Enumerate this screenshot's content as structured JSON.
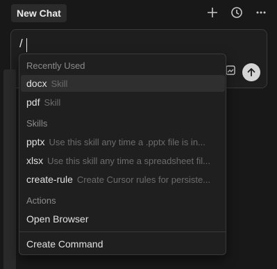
{
  "header": {
    "title": "New Chat",
    "icons": [
      "plus-icon",
      "history-icon",
      "more-icon"
    ]
  },
  "composer": {
    "value": "/",
    "icons": [
      "attach-icon",
      "arrow-up-icon"
    ]
  },
  "menu": {
    "sections": {
      "recent": "Recently Used",
      "skills": "Skills",
      "actions": "Actions"
    },
    "recent": [
      {
        "name": "docx",
        "desc": "Skill"
      },
      {
        "name": "pdf",
        "desc": "Skill"
      }
    ],
    "skills": [
      {
        "name": "pptx",
        "desc": "Use this skill any time a .pptx file is in..."
      },
      {
        "name": "xlsx",
        "desc": "Use this skill any time a spreadsheet fil..."
      },
      {
        "name": "create-rule",
        "desc": "Create Cursor rules for persiste..."
      }
    ],
    "actions": [
      {
        "name": "Open Browser"
      }
    ],
    "footer": {
      "name": "Create Command"
    }
  },
  "colors": {
    "background": "#181818",
    "panel": "#1f1f1f",
    "selected": "#2f2f2f",
    "muted": "#6c6c6c"
  }
}
